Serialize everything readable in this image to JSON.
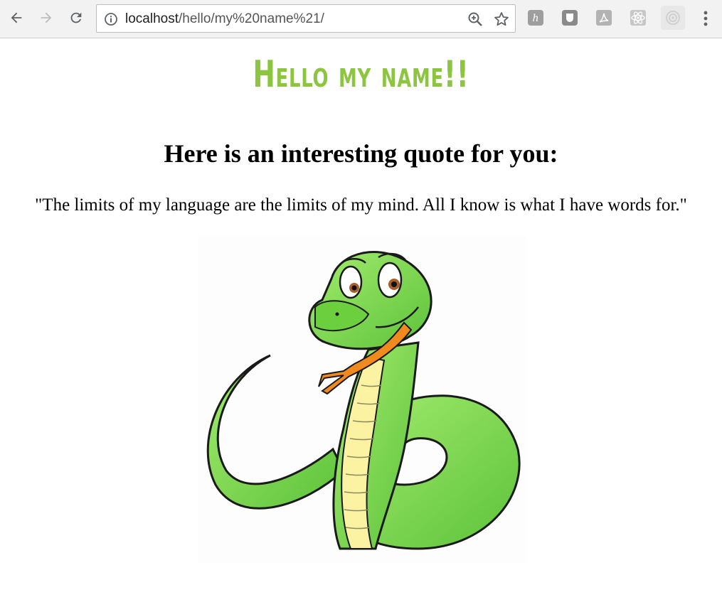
{
  "browser": {
    "url_host": "localhost",
    "url_path": "/hello/my%20name%21/",
    "icons": [
      "back-icon",
      "forward-icon",
      "reload-icon",
      "info-icon",
      "zoom-icon",
      "bookmark-star-icon",
      "extension-h-icon",
      "extension-shield-icon",
      "extension-pdf-icon",
      "extension-react-icon",
      "extension-target-icon",
      "menu-icon"
    ]
  },
  "page": {
    "title": "Hello my name!!",
    "subheading": "Here is an interesting quote for you:",
    "quote": "\"The limits of my language are the limits of my mind. All I know is what I have words for.\"",
    "image": "snake-illustration"
  },
  "colors": {
    "title": "#8cc641",
    "snake_body": "#7dd84a",
    "snake_belly": "#fbf3a2",
    "tongue": "#f08a1e"
  }
}
